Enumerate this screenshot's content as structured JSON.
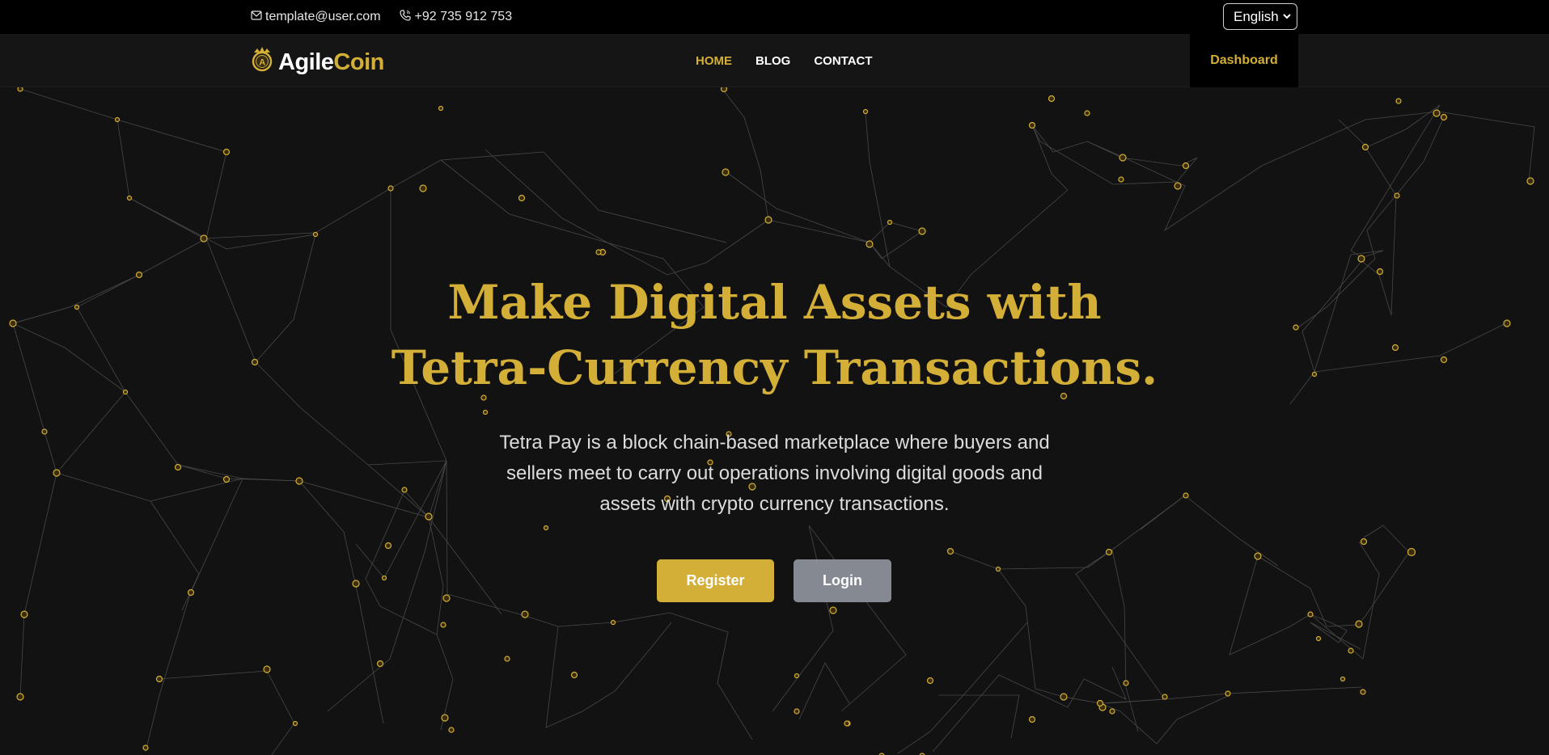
{
  "topbar": {
    "email": "template@user.com",
    "phone": "+92 735 912 753",
    "language": "English"
  },
  "navbar": {
    "logo_part1": "Agile",
    "logo_part2": "Coin",
    "links": [
      {
        "label": "HOME",
        "active": true
      },
      {
        "label": "BLOG",
        "active": false
      },
      {
        "label": "CONTACT",
        "active": false
      }
    ],
    "dashboard_label": "Dashboard"
  },
  "hero": {
    "title_line1": "Make Digital Assets with",
    "title_line2": "Tetra-Currency Transactions.",
    "subtitle": "Tetra Pay is a block chain-based marketplace where buyers and sellers meet to carry out operations involving digital goods and assets with crypto currency transactions.",
    "register_label": "Register",
    "login_label": "Login"
  },
  "colors": {
    "accent": "#d4af37",
    "background": "#121212",
    "topbar": "#000000",
    "login_button": "#858a92"
  }
}
